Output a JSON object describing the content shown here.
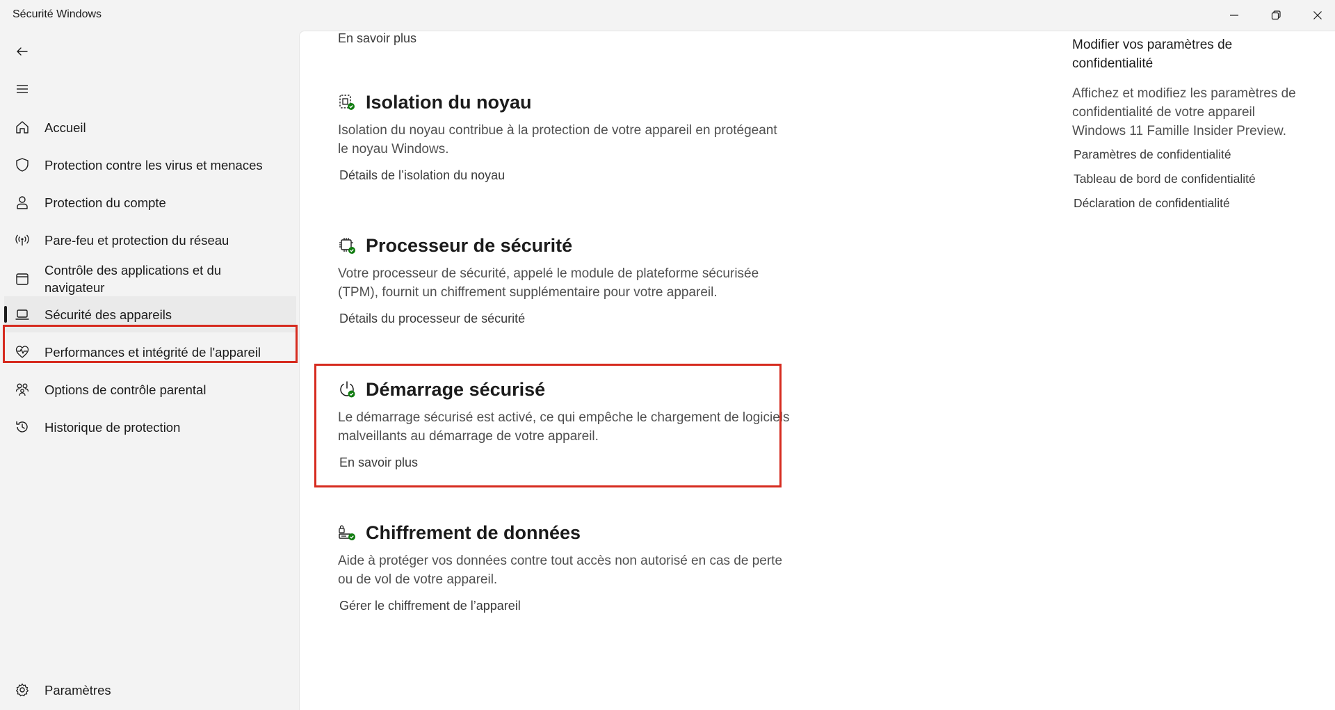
{
  "window": {
    "title": "Sécurité Windows"
  },
  "sidebar": {
    "items": [
      {
        "label": "Accueil",
        "icon": "home-icon"
      },
      {
        "label": "Protection contre les virus et menaces",
        "icon": "shield-icon"
      },
      {
        "label": "Protection du compte",
        "icon": "person-icon"
      },
      {
        "label": "Pare-feu et protection du réseau",
        "icon": "wireless-icon"
      },
      {
        "label": "Contrôle des applications et du navigateur",
        "icon": "browser-window-icon"
      },
      {
        "label": "Sécurité des appareils",
        "icon": "laptop-icon",
        "active": true
      },
      {
        "label": "Performances et intégrité de l'appareil",
        "icon": "heart-pulse-icon"
      },
      {
        "label": "Options de contrôle parental",
        "icon": "family-icon"
      },
      {
        "label": "Historique de protection",
        "icon": "history-icon"
      }
    ],
    "settings_label": "Paramètres"
  },
  "main": {
    "top_link": "En savoir plus",
    "sections": [
      {
        "title": "Isolation du noyau",
        "description": "Isolation du noyau contribue à la protection de votre appareil en protégeant le noyau Windows.",
        "link": "Détails de l’isolation du noyau",
        "icon": "core-isolation-icon"
      },
      {
        "title": "Processeur de sécurité",
        "description": "Votre processeur de sécurité, appelé le module de plateforme sécurisée (TPM), fournit un chiffrement supplémentaire pour votre appareil.",
        "link": "Détails du processeur de sécurité",
        "icon": "security-processor-icon"
      },
      {
        "title": "Démarrage sécurisé",
        "description": "Le démarrage sécurisé est activé, ce qui empêche le chargement de logiciels malveillants au démarrage de votre appareil.",
        "link": "En savoir plus",
        "icon": "secure-boot-icon"
      },
      {
        "title": "Chiffrement de données",
        "description": "Aide à protéger vos données contre tout accès non autorisé en cas de perte ou de vol de votre appareil.",
        "link": "Gérer le chiffrement de l’appareil",
        "icon": "data-encryption-icon"
      }
    ]
  },
  "right_panel": {
    "title": "Modifier vos paramètres de confidentialité",
    "description": "Affichez et modifiez les paramètres de confidentialité de votre appareil Windows 11 Famille Insider Preview.",
    "links": [
      "Paramètres de confidentialité",
      "Tableau de bord de confidentialité",
      "Déclaration de confidentialité"
    ]
  },
  "colors": {
    "highlight": "#d62b1f",
    "check_green": "#107c10",
    "text": "#1b1b1b",
    "muted": "#505050"
  }
}
